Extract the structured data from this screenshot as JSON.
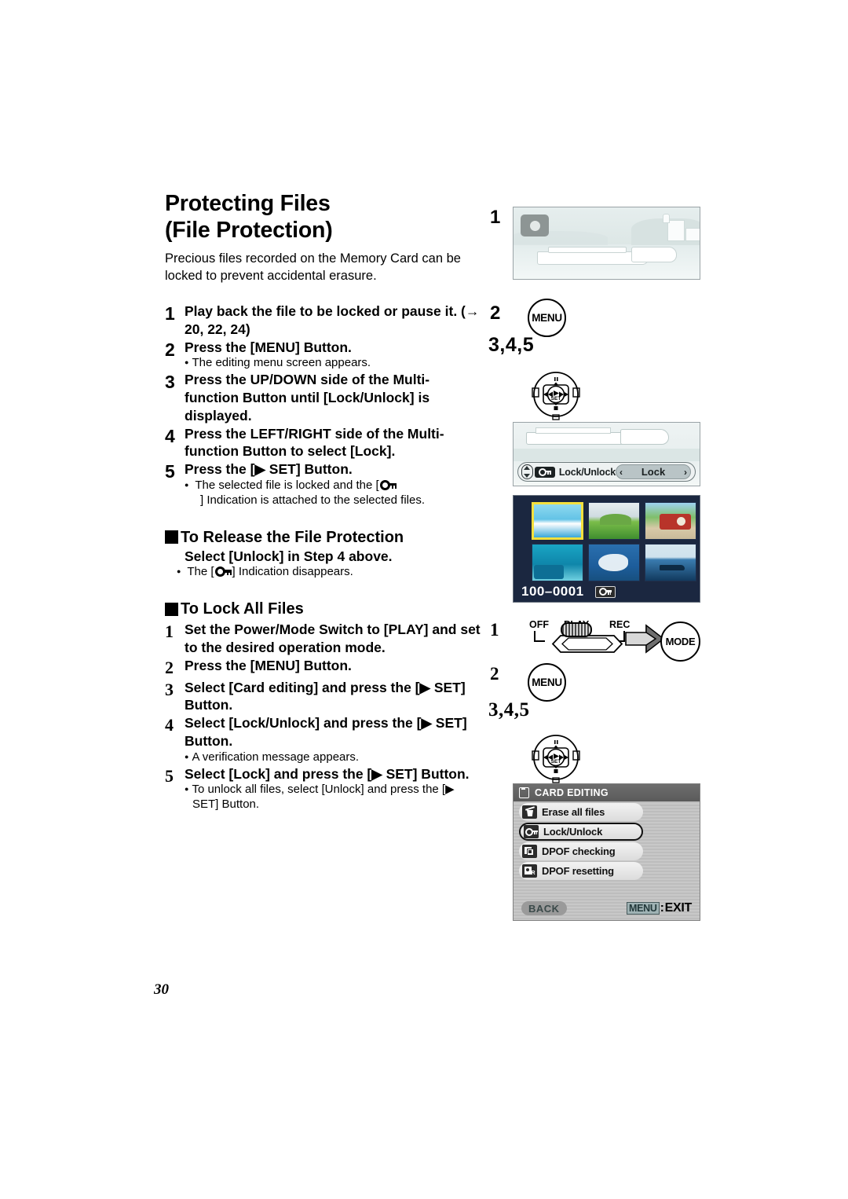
{
  "page": {
    "number": "30"
  },
  "heading": {
    "line1": "Protecting Files",
    "line2": "(File Protection)"
  },
  "intro": "Precious files recorded on the Memory Card can be locked to prevent accidental erasure.",
  "main_steps": [
    {
      "num": "1",
      "text": "Play back the file to be locked or pause it. (→ 20, 22, 24)"
    },
    {
      "num": "2",
      "text": "Press the [MENU] Button.",
      "bullets": [
        "The editing menu screen appears."
      ]
    },
    {
      "num": "3",
      "text": "Press the UP/DOWN side of the Multi-function Button until [Lock/Unlock] is displayed."
    },
    {
      "num": "4",
      "text": "Press the LEFT/RIGHT side of the Multi-function Button to select [Lock]."
    },
    {
      "num": "5",
      "text": "Press the [▶ SET] Button.",
      "bullet_pre": "The selected file is locked and the [",
      "bullet_post": "] Indication is attached to the selected files."
    }
  ],
  "release_section": {
    "title": "To Release the File Protection",
    "subtitle": "Select [Unlock] in Step 4 above.",
    "bullet_pre": "The [",
    "bullet_post": "] Indication disappears."
  },
  "lockall_section": {
    "title": "To Lock All Files",
    "steps": [
      {
        "num": "1",
        "text": "Set the Power/Mode Switch to [PLAY] and set to the desired operation mode."
      },
      {
        "num": "2",
        "text": "Press the [MENU] Button."
      },
      {
        "num": "3",
        "text": "Select [Card editing] and press the [▶ SET] Button."
      },
      {
        "num": "4",
        "text": "Select [Lock/Unlock] and press the [▶ SET] Button.",
        "bullets": [
          "A verification message appears."
        ]
      },
      {
        "num": "5",
        "text": "Select [Lock] and press the [▶ SET] Button.",
        "bullets": [
          "To unlock all files, select [Unlock] and press the [▶ SET] Button."
        ]
      }
    ]
  },
  "illustrations": {
    "label_1a": "1",
    "label_2a": "2",
    "label_345a": "3,4,5",
    "label_1b": "1",
    "label_2b": "2",
    "label_345b": "3,4,5",
    "menu_button": "MENU",
    "menu_button_2": "MENU",
    "mode_button": "MODE",
    "set_center": "SET",
    "power_switch": {
      "off": "OFF",
      "play": "PLAY",
      "rec": "REC"
    }
  },
  "lcd_lock_unlock": {
    "label": "Lock/Unlock",
    "value": "Lock",
    "chev_left": "‹",
    "chev_right": "›"
  },
  "lcd_thumbnails": {
    "file_id": "100–0001",
    "selected_index": 0,
    "thumbs": [
      {
        "name": "beach",
        "c1": "#8fd9ef",
        "c2": "#3aa8d8",
        "c3": "#ffffff"
      },
      {
        "name": "green-hill",
        "c1": "#dfe7ea",
        "c2": "#7bbd4a",
        "c3": "#3f8f2f"
      },
      {
        "name": "red-train",
        "c1": "#7fbf6a",
        "c2": "#b8342a",
        "c3": "#d8c9a8"
      },
      {
        "name": "underwater",
        "c1": "#19a5c4",
        "c2": "#0d6f95",
        "c3": "#6fd0e0"
      },
      {
        "name": "whale",
        "c1": "#2a6fae",
        "c2": "#ffffff",
        "c3": "#17507f"
      },
      {
        "name": "dark-boat",
        "c1": "#d6e6ef",
        "c2": "#2f6aa0",
        "c3": "#123a5e"
      }
    ]
  },
  "lcd_card_editing": {
    "header": "CARD EDITING",
    "items": [
      {
        "label": "Erase all files",
        "icon": "trash-icon",
        "selected": false
      },
      {
        "label": "Lock/Unlock",
        "icon": "lock-key-icon",
        "selected": true
      },
      {
        "label": "DPOF checking",
        "icon": "dpof-check-icon",
        "selected": false
      },
      {
        "label": "DPOF resetting",
        "icon": "dpof-reset-icon",
        "selected": false
      }
    ],
    "back_label": "BACK",
    "menu_label": "MENU",
    "exit_label": "EXIT",
    "exit_sep": ":"
  },
  "colors": {
    "select_yellow": "#f5e03c",
    "lcd_navy": "#1b2740",
    "menu_header_gray": "#5a5a5a",
    "menu_teal": "#9fb2b4"
  }
}
